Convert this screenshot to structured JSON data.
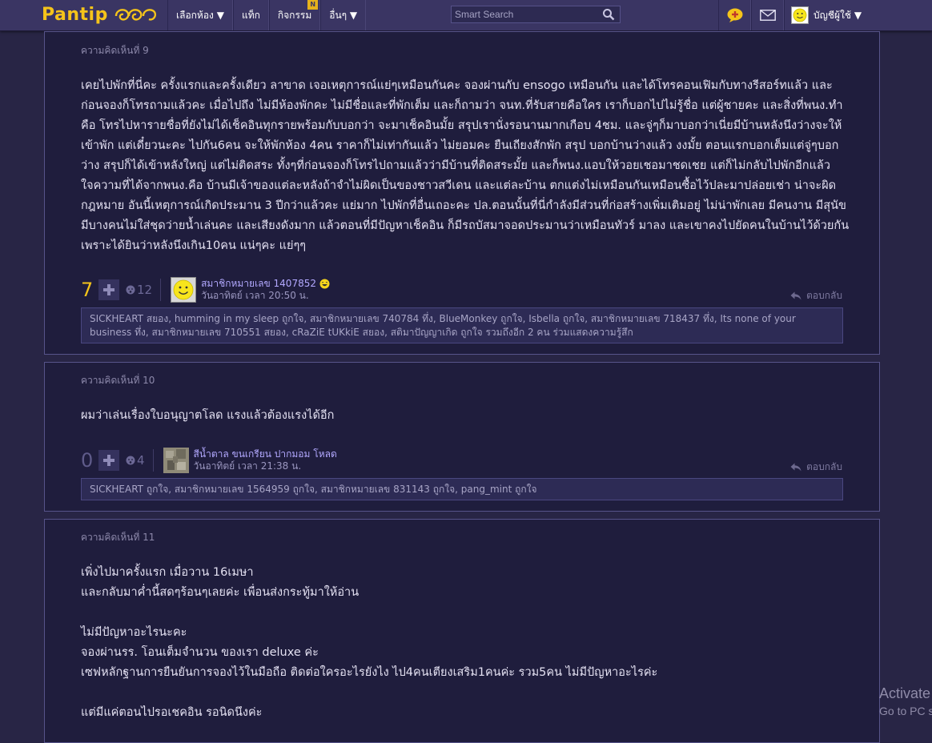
{
  "header": {
    "logo_text": "Pantip",
    "nav": [
      {
        "label": "เลือกห้อง ▼"
      },
      {
        "label": "แท็ก"
      },
      {
        "label": "กิจกรรม",
        "badge": "N"
      },
      {
        "label": "อื่นๆ ▼"
      }
    ],
    "search_placeholder": "Smart Search",
    "account_label": "บัญชีผู้ใช้ ▼"
  },
  "comments": [
    {
      "number": "ความคิดเห็นที่ 9",
      "paragraphs": [
        "เคยไปพักที่นี่คะ ครั้งแรกและครั้งเดียว ลาขาด เจอเหตุการณ์แย่ๆเหมือนกันคะ จองผ่านกับ ensogo เหมือนกัน และได้โทรคอนเฟิมกับทางรีสอร์ทแล้ว และก่อนจองก็โทรถามแล้วคะ เมื่อไปถึง ไม่มีห้องพักคะ ไม่มีชื่อและที่พักเต็ม และก็ถามว่า จนท.ที่รับสายคือใคร เราก็บอกไปไม่รู้ชื่อ แต่ผู้ชายคะ และสิ่งที่พนง.ทำคือ โทรไปหารายชื่อที่ยังไม่ได้เช็คอินทุกรายพร้อมกับบอกว่า จะมาเช็คอินมั้ย สรุปเรานั่งรอนานมากเกือบ 4ชม. และจู่ๆก็มาบอกว่าเนี่ยมีบ้านหลังนึงว่างจะให้เข้าพัก แต่เดี๋ยวนะคะ ไปกัน6คน จะให้พักห้อง 4คน ราคาก็ไม่เท่ากันแล้ว ไม่ยอมคะ ยืนเถียงสักพัก สรุป บอกบ้านว่างแล้ว งงมั้ย ตอนแรกบอกเต็มแต่จู่ๆบอกว่าง สรุปก็ได้เข้าหลังใหญ่ แต่ไม่ติดสระ ทั้งๆที่ก่อนจองก็โทรไปถามแล้วว่ามีบ้านที่ติดสระมั้ย และก็พนง.แอบให้วอยเชอมาชดเชย แต่ก็ไม่กลับไปพักอีกแล้ว ใจความที่ได้จากพนง.คือ บ้านมีเจ้าของแต่ละหลังถ้าจำไม่ผิดเป็นของชาวสวีเดน และแต่ละบ้าน ตกแต่งไม่เหมือนกันเหมือนซื้อไว้ปละมาปล่อยเช่า น่าจะผิดกฎหมาย อันนี้เหตุการณ์เกิดประมาน 3 ปีกว่าแล้วคะ แย่มาก ไปพักที่อื่นเถอะคะ ปล.ตอนนั้นที่นี่กำลังมีส่วนที่ก่อสร้างเพิ่มเติมอยู่ ไม่น่าพักเลย มีคนงาน มีสุนัข มีบางคนไม่ใส่ชุดว่ายน้ำเล่นคะ และเสียงดังมาก แล้วตอนที่มีปัญหาเช็คอิน ก็มีรถบัสมาจอดประมานว่าเหมือนทัวร์ มาลง และเขาคงไปยัดคนในบ้านไว้ด้วยกัน เพราะได้ยินว่าหลังนึงเกิน10คน แน่ๆคะ แย่ๆๆ"
      ],
      "score": "7",
      "emote_count": "12",
      "user_name": "สมาชิกหมายเลข 1407852",
      "timestamp": "วันอาทิตย์ เวลา 20:50 น.",
      "reply_label": "ตอบกลับ",
      "reactions": "SICKHEART สยอง, humming in my sleep ถูกใจ, สมาชิกหมายเลข 740784 ทึ่ง, BlueMonkey ถูกใจ, Isbella ถูกใจ, สมาชิกหมายเลข 718437 ทึ่ง, Its none of your business ทึ่ง, สมาชิกหมายเลข 710551 สยอง, cRaZiE tUKkiE สยอง, สติมาปัญญาเกิด ถูกใจ รวมถึงอีก 2 คน ร่วมแสดงความรู้สึก"
    },
    {
      "number": "ความคิดเห็นที่ 10",
      "paragraphs": [
        "ผมว่าเล่นเรื่องใบอนุญาตโลด แรงแล้วต้องแรงได้อีก"
      ],
      "score": "0",
      "emote_count": "4",
      "user_name": "สีน้ำตาล ขนเกรียน ปากมอม โหลด",
      "timestamp": "วันอาทิตย์ เวลา 21:38 น.",
      "reply_label": "ตอบกลับ",
      "reactions": "SICKHEART ถูกใจ, สมาชิกหมายเลข 1564959 ถูกใจ, สมาชิกหมายเลข 831143 ถูกใจ, pang_mint ถูกใจ"
    },
    {
      "number": "ความคิดเห็นที่ 11",
      "lines": [
        "เพิ่งไปมาครั้งแรก เมื่อวาน 16เมษา",
        "และกลับมาค่ำนี้สดๆร้อนๆเลยค่ะ เพื่อนส่งกระทู้มาให้อ่าน",
        "",
        "ไม่มีปัญหาอะไรนะคะ",
        "จองผ่านรร. โอนเต็มจำนวน ของเรา deluxe ค่ะ",
        "เซฟหลักฐานการยืนยันการจองไว้ในมือถือ ติดต่อใครอะไรยังไง ไป4คนเตียงเสริม1คนค่ะ รวม5คน ไม่มีปัญหาอะไรค่ะ",
        "",
        "แต่มีแค่ตอนไปรอเชคอิน รอนิดนึงค่ะ"
      ]
    }
  ],
  "watermark": {
    "title": "Activate",
    "subtitle": "Go to PC s"
  }
}
